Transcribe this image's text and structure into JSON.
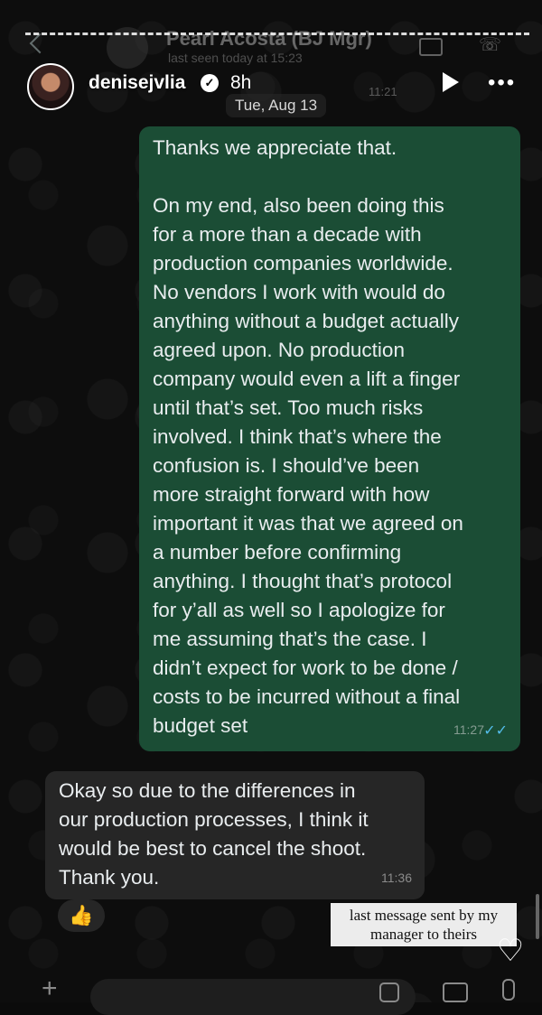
{
  "chat_header": {
    "contact_name": "Pearl Acosta (BJ Mgr)",
    "status": "last seen today at 15:23"
  },
  "story": {
    "username": "denisejvlia",
    "time_ago": "8h"
  },
  "old_time": "11:21",
  "date_chip": "Tue, Aug 13",
  "messages": [
    {
      "direction": "out",
      "text": "Thanks we appreciate that.\n\nOn my end, also been doing this\nfor a more than a decade with\nproduction companies worldwide.\nNo vendors I work with would do\nanything without a budget actually\nagreed upon. No production\ncompany would even a lift a finger\nuntil that’s set. Too much risks\ninvolved. I think that’s where the\nconfusion is. I should’ve been\nmore straight forward with how\nimportant it was that we agreed on\na number before confirming\nanything. I thought that’s protocol\nfor y’all as well so I apologize for\nme assuming that’s the case. I\ndidn’t expect for work to be done /\ncosts to be incurred without a final\nbudget set",
      "time": "11:27"
    },
    {
      "direction": "in",
      "text": "Okay so due to the differences in\nour production processes, I think it\nwould be best to cancel the shoot.\nThank you.",
      "time": "11:36",
      "reaction": "👍"
    }
  ],
  "caption": "last message sent by my manager to theirs",
  "icons": {
    "heart": "heart-icon",
    "play": "play-icon",
    "more": "more-icon"
  }
}
